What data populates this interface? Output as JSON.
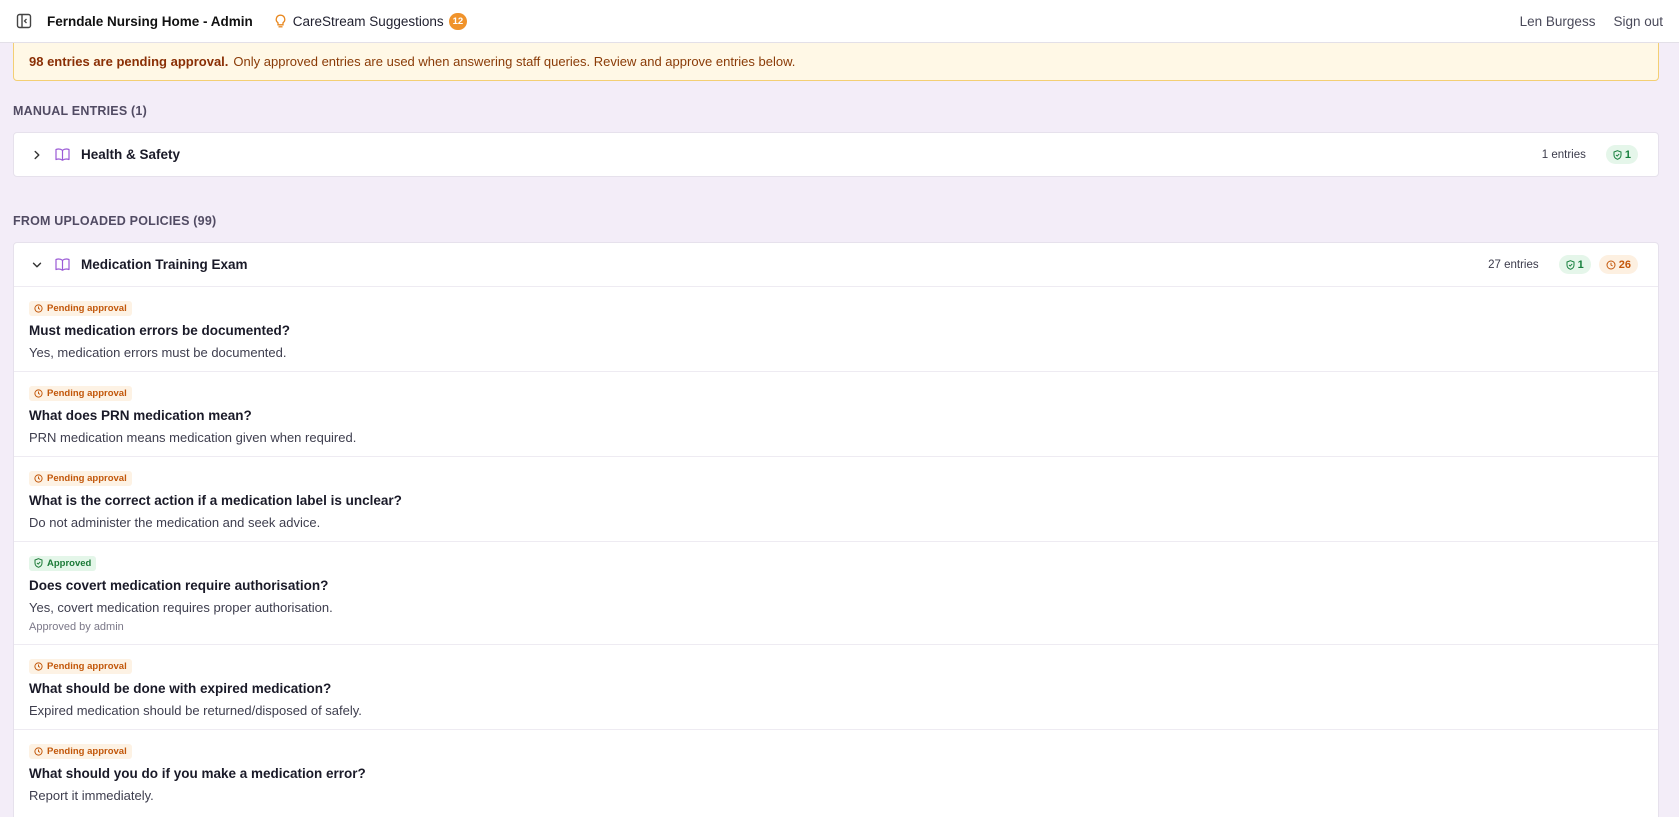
{
  "header": {
    "app_title": "Ferndale Nursing Home - Admin",
    "suggestions_label": "CareStream Suggestions",
    "suggestions_count": "12",
    "user_name": "Len Burgess",
    "signout_label": "Sign out"
  },
  "banner": {
    "strong": "98 entries are pending approval.",
    "text": "Only approved entries are used when answering staff queries. Review and approve entries below."
  },
  "manual": {
    "title": "MANUAL ENTRIES (1)",
    "cards": [
      {
        "title": "Health & Safety",
        "entries": "1 entries",
        "approved": "1"
      }
    ]
  },
  "uploaded": {
    "title": "FROM UPLOADED POLICIES (99)",
    "card": {
      "title": "Medication Training Exam",
      "entries": "27 entries",
      "approved": "1",
      "pending": "26",
      "items": [
        {
          "status": "Pending approval",
          "question": "Must medication errors be documented?",
          "answer": "Yes, medication errors must be documented."
        },
        {
          "status": "Pending approval",
          "question": "What does PRN medication mean?",
          "answer": "PRN medication means medication given when required."
        },
        {
          "status": "Pending approval",
          "question": "What is the correct action if a medication label is unclear?",
          "answer": "Do not administer the medication and seek advice."
        },
        {
          "status": "Approved",
          "question": "Does covert medication require authorisation?",
          "answer": "Yes, covert medication requires proper authorisation.",
          "approved_by": "Approved by admin"
        },
        {
          "status": "Pending approval",
          "question": "What should be done with expired medication?",
          "answer": "Expired medication should be returned/disposed of safely."
        },
        {
          "status": "Pending approval",
          "question": "What should you do if you make a medication error?",
          "answer": "Report it immediately."
        }
      ]
    }
  },
  "colors": {
    "page_bg": "#f3edf8",
    "accent_orange": "#f0932b",
    "approved_green": "#17803d",
    "pending_orange": "#c4570b",
    "book_purple": "#9b5bd6"
  }
}
